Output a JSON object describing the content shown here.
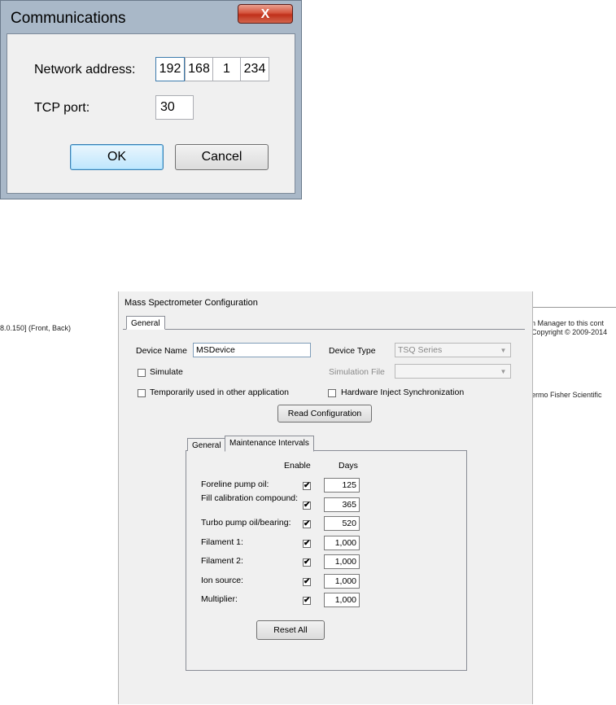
{
  "comm_dialog": {
    "title": "Communications",
    "close_label": "X",
    "network_label": "Network address:",
    "ip": [
      "192",
      "168",
      "1",
      "234"
    ],
    "tcp_label": "TCP port:",
    "tcp_value": "30",
    "ok_label": "OK",
    "cancel_label": "Cancel"
  },
  "background": {
    "left_text": "8.0.150] (Front, Back)",
    "right_text_1": "n Manager to this cont",
    "right_text_2": "Copyright © 2009-2014",
    "right_text_3": "ermo Fisher Scientific"
  },
  "ms_config": {
    "title": "Mass Spectrometer Configuration",
    "outer_tab": "General",
    "device_name_label": "Device Name",
    "device_name_value": "MSDevice",
    "device_type_label": "Device Type",
    "device_type_value": "TSQ Series",
    "simulate_label": "Simulate",
    "simulation_file_label": "Simulation File",
    "temp_used_label": "Temporarily used in other application",
    "hw_inject_label": "Hardware Inject Synchronization",
    "read_config_label": "Read Configuration",
    "inner_tabs": [
      "General",
      "Maintenance Intervals"
    ],
    "col_enable": "Enable",
    "col_days": "Days",
    "check_mark": "✔",
    "intervals": [
      {
        "label": "Foreline pump oil:",
        "enabled": true,
        "days": "125"
      },
      {
        "label": "Fill calibration compound:",
        "enabled": true,
        "days": "365"
      },
      {
        "label": "Turbo pump oil/bearing:",
        "enabled": true,
        "days": "520"
      },
      {
        "label": "Filament 1:",
        "enabled": true,
        "days": "1,000"
      },
      {
        "label": "Filament 2:",
        "enabled": true,
        "days": "1,000"
      },
      {
        "label": "Ion source:",
        "enabled": true,
        "days": "1,000"
      },
      {
        "label": "Multiplier:",
        "enabled": true,
        "days": "1,000"
      }
    ],
    "reset_label": "Reset All"
  }
}
